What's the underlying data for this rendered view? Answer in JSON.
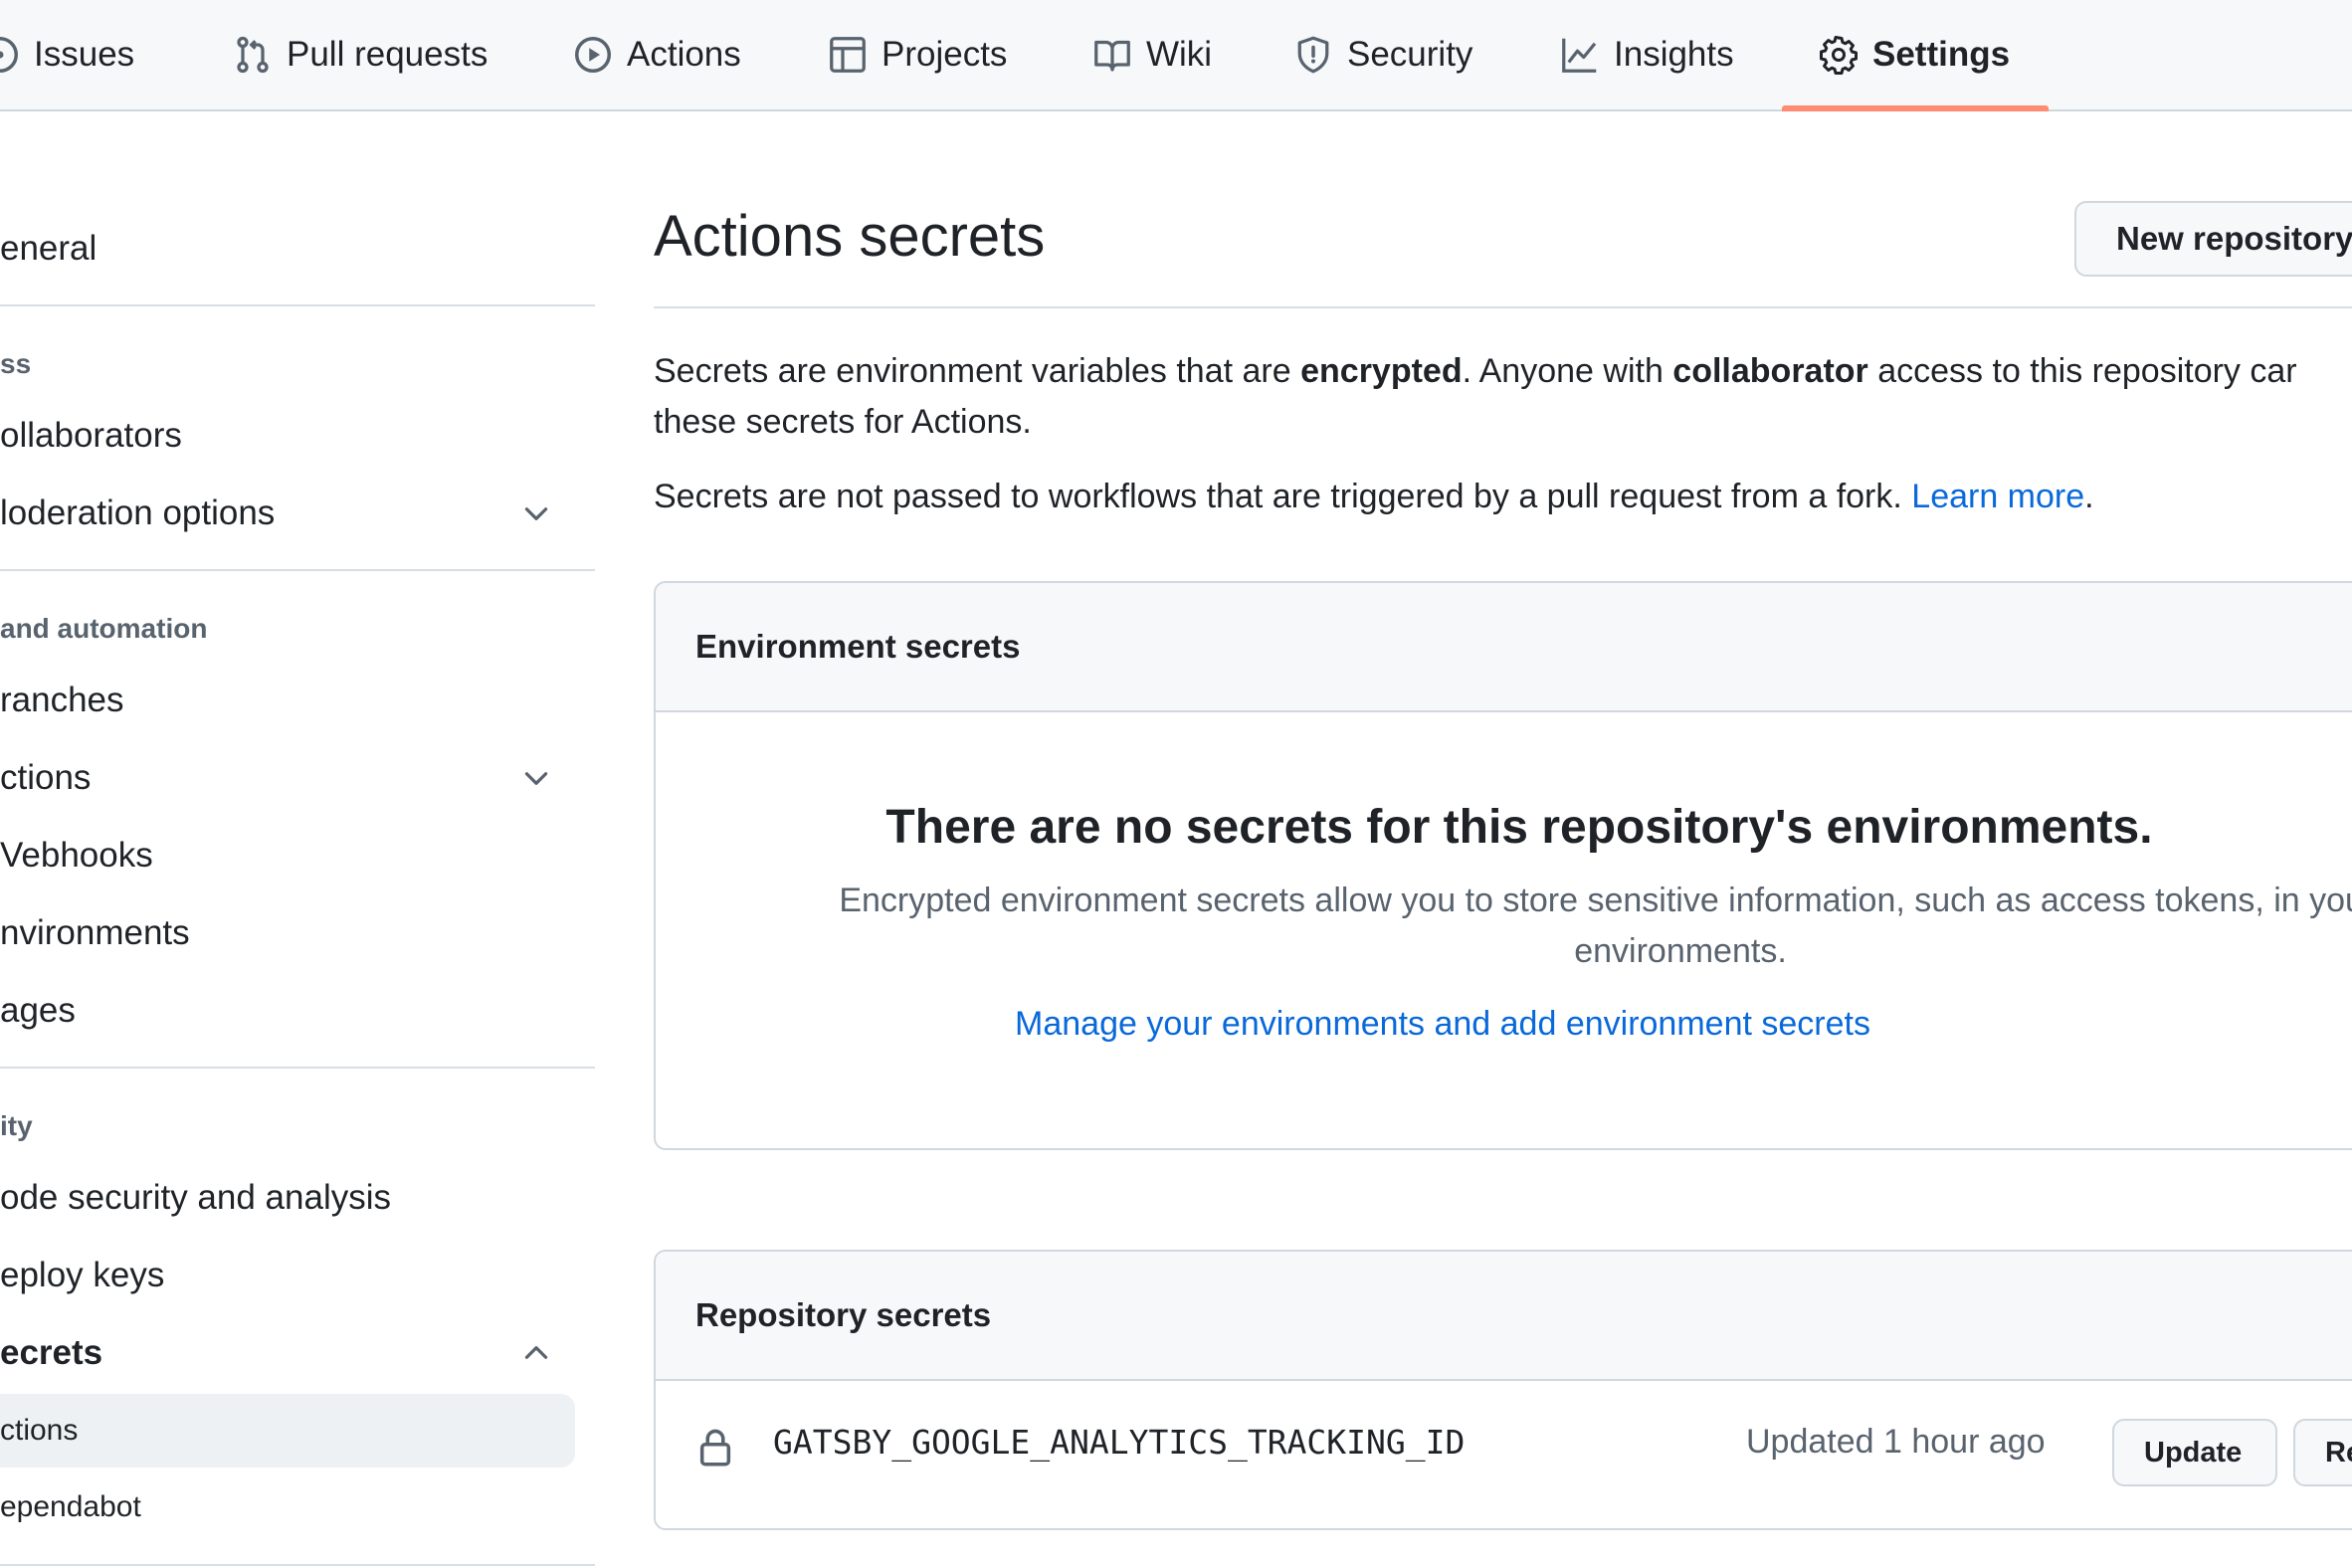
{
  "repo_nav": {
    "tabs": [
      {
        "label": "Issues",
        "icon": "issue-circle-icon"
      },
      {
        "label": "Pull requests",
        "icon": "pull-request-icon"
      },
      {
        "label": "Actions",
        "icon": "play-circle-icon"
      },
      {
        "label": "Projects",
        "icon": "table-icon"
      },
      {
        "label": "Wiki",
        "icon": "book-icon"
      },
      {
        "label": "Security",
        "icon": "shield-icon"
      },
      {
        "label": "Insights",
        "icon": "graph-icon"
      },
      {
        "label": "Settings",
        "icon": "gear-icon"
      }
    ],
    "selected_tab": "Settings"
  },
  "sidebar": {
    "general": "eneral",
    "access_heading": "ss",
    "collaborators": "ollaborators",
    "moderation": "loderation options",
    "code_heading": "and automation",
    "branches": "ranches",
    "actions": "ctions",
    "webhooks": "Vebhooks",
    "environments": "nvironments",
    "pages": "ages",
    "security_heading": "ity",
    "code_security": "ode security and analysis",
    "deploy_keys": "eploy keys",
    "secrets": "ecrets",
    "secrets_actions": "ctions",
    "secrets_dependabot": "ependabot"
  },
  "main": {
    "title": "Actions secrets",
    "new_secret_button": "New repository",
    "description": {
      "part1": "Secrets are environment variables that are ",
      "bold1": "encrypted",
      "part2": ". Anyone with ",
      "bold2": "collaborator",
      "part3": " access to this repository car",
      "part4": "these secrets for Actions."
    },
    "fork_note": {
      "text": "Secrets are not passed to workflows that are triggered by a pull request from a fork. ",
      "link": "Learn more",
      "end": "."
    },
    "environment_secrets": {
      "header": "Environment secrets",
      "blank_title": "There are no secrets for this repository's environments.",
      "blank_description": "Encrypted environment secrets allow you to store sensitive information, such as access tokens, in you repository environments.",
      "manage_link": "Manage your environments and add environment secrets"
    },
    "repository_secrets": {
      "header": "Repository secrets",
      "items": [
        {
          "name": "GATSBY_GOOGLE_ANALYTICS_TRACKING_ID",
          "updated": "Updated 1 hour ago",
          "update_label": "Update",
          "remove_label": "Re"
        }
      ]
    }
  },
  "colors": {
    "link": "#0969da",
    "tab_underline": "#fd8c73",
    "muted_text": "#59636e",
    "border": "#d0d7de"
  }
}
